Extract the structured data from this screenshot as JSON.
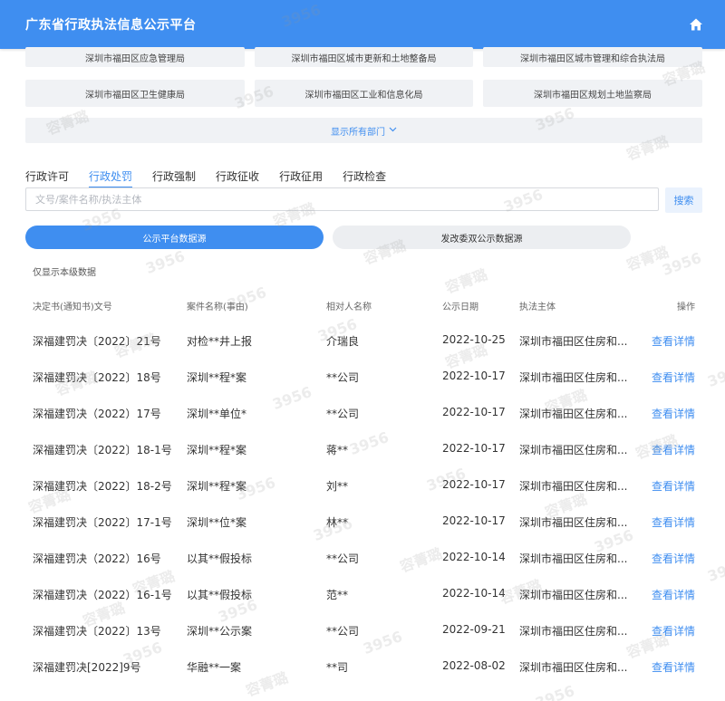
{
  "header": {
    "title": "广东省行政执法信息公示平台",
    "home_icon": "home-icon"
  },
  "departments": [
    [
      "深圳市福田区应急管理局",
      "深圳市福田区城市更新和土地整备局",
      "深圳市福田区城市管理和综合执法局"
    ],
    [
      "深圳市福田区卫生健康局",
      "深圳市福田区工业和信息化局",
      "深圳市福田区规划土地监察局"
    ]
  ],
  "show_all": {
    "label": "显示所有部门",
    "icon": "chevron-down-icon"
  },
  "tabs": [
    "行政许可",
    "行政处罚",
    "行政强制",
    "行政征收",
    "行政征用",
    "行政检查"
  ],
  "active_tab": 1,
  "search": {
    "placeholder": "文号/案件名称/执法主体",
    "button": "搜索"
  },
  "source_toggle": {
    "option_a": "公示平台数据源",
    "option_b": "发改委双公示数据源",
    "selected": "option_a"
  },
  "filter_note": "仅显示本级数据",
  "table": {
    "headers": [
      "决定书(通知书)文号",
      "案件名称(事由)",
      "相对人名称",
      "公示日期",
      "执法主体",
      "操作"
    ],
    "rows": [
      [
        "深福建罚决〔2022〕21号",
        "对检**井上报",
        "介瑞良",
        "2022-10-25",
        "深圳市福田区住房和...",
        "查看详情"
      ],
      [
        "深福建罚决〔2022〕18号",
        "深圳**程*案",
        "**公司",
        "2022-10-17",
        "深圳市福田区住房和...",
        "查看详情"
      ],
      [
        "深福建罚决（2022）17号",
        "深圳**单位*",
        "**公司",
        "2022-10-17",
        "深圳市福田区住房和...",
        "查看详情"
      ],
      [
        "深福建罚决〔2022〕18-1号",
        "深圳**程*案",
        "蒋**",
        "2022-10-17",
        "深圳市福田区住房和...",
        "查看详情"
      ],
      [
        "深福建罚决〔2022〕18-2号",
        "深圳**程*案",
        "刘**",
        "2022-10-17",
        "深圳市福田区住房和...",
        "查看详情"
      ],
      [
        "深福建罚决〔2022〕17-1号",
        "深圳**位*案",
        "林**",
        "2022-10-17",
        "深圳市福田区住房和...",
        "查看详情"
      ],
      [
        "深福建罚决（2022）16号",
        "以其**假投标",
        "**公司",
        "2022-10-14",
        "深圳市福田区住房和...",
        "查看详情"
      ],
      [
        "深福建罚决（2022）16-1号",
        "以其**假投标",
        "范**",
        "2022-10-14",
        "深圳市福田区住房和...",
        "查看详情"
      ],
      [
        "深福建罚决〔2022〕13号",
        "深圳**公示案",
        "**公司",
        "2022-09-21",
        "深圳市福田区住房和...",
        "查看详情"
      ],
      [
        "深福建罚决[2022]9号",
        "华融**一案",
        "**司",
        "2022-08-02",
        "深圳市福田区住房和...",
        "查看详情"
      ]
    ]
  },
  "watermark": {
    "texts": [
      "3956",
      "容菁璐"
    ]
  },
  "colors": {
    "primary": "#3f8ef0",
    "header_bg": "#3f8ef0",
    "button_bg": "#f0f2f5"
  }
}
